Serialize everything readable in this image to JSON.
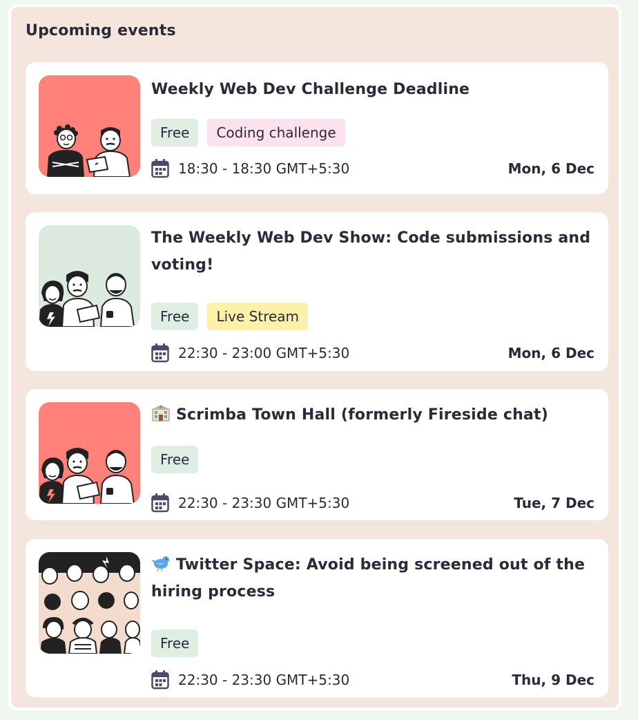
{
  "panel": {
    "title": "Upcoming events"
  },
  "events": [
    {
      "title": "Weekly Web Dev Challenge Deadline",
      "emoji": "",
      "image": "two-developers-illustration-coral",
      "tags": [
        {
          "label": "Free",
          "kind": "free"
        },
        {
          "label": "Coding challenge",
          "kind": "coding"
        }
      ],
      "time": "18:30 - 18:30 GMT+5:30",
      "date": "Mon, 6 Dec"
    },
    {
      "title": "The Weekly Web Dev Show: Code submissions and voting!",
      "emoji": "",
      "image": "three-developers-illustration-mint",
      "tags": [
        {
          "label": "Free",
          "kind": "free"
        },
        {
          "label": "Live Stream",
          "kind": "live"
        }
      ],
      "time": "22:30 - 23:00 GMT+5:30",
      "date": "Mon, 6 Dec"
    },
    {
      "title": "Scrimba Town Hall (formerly Fireside chat)",
      "emoji": "school-building-emoji",
      "image": "three-developers-illustration-coral",
      "tags": [
        {
          "label": "Free",
          "kind": "free"
        }
      ],
      "time": "22:30 - 23:30 GMT+5:30",
      "date": "Tue, 7 Dec"
    },
    {
      "title": "Twitter Space: Avoid being screened out of the hiring process",
      "emoji": "bird-emoji",
      "image": "crowd-illustration-peach",
      "tags": [
        {
          "label": "Free",
          "kind": "free"
        }
      ],
      "time": "22:30 - 23:30 GMT+5:30",
      "date": "Thu, 9 Dec"
    }
  ],
  "colors": {
    "panel_bg": "#f4e6dc",
    "tag_free": "#dfeee2",
    "tag_coding": "#fce1ee",
    "tag_live": "#fdf0a8",
    "calendar_icon": "#4a4a6a",
    "thumb_coral": "#ff8179",
    "thumb_mint": "#dce9df",
    "thumb_peach": "#f3dccd"
  }
}
